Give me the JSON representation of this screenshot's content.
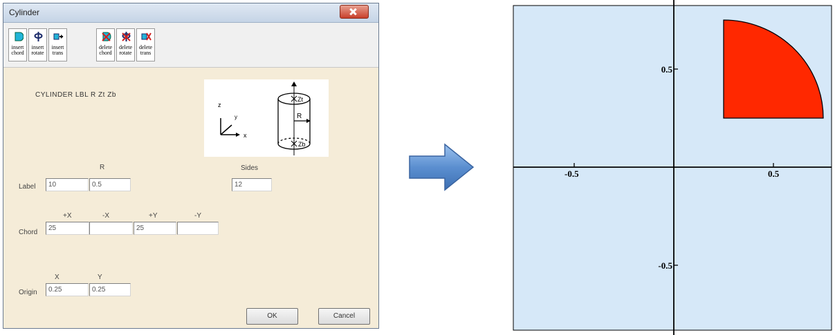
{
  "dialog": {
    "title": "Cylinder",
    "toolbar": [
      {
        "line1": "insert",
        "line2": "chord",
        "icon": "insert-chord-icon"
      },
      {
        "line1": "insert",
        "line2": "rotate",
        "icon": "insert-rotate-icon"
      },
      {
        "line1": "insert",
        "line2": "trans",
        "icon": "insert-trans-icon"
      },
      {
        "line1": "delete",
        "line2": "chord",
        "icon": "delete-chord-icon"
      },
      {
        "line1": "delete",
        "line2": "rotate",
        "icon": "delete-rotate-icon"
      },
      {
        "line1": "delete",
        "line2": "trans",
        "icon": "delete-trans-icon"
      }
    ],
    "header": "CYLINDER  LBL  R  Zt  Zb",
    "diagram": {
      "z": "z",
      "y": "y",
      "x": "x",
      "zt": "Zt",
      "r": "R",
      "zb": "Zb"
    },
    "label_row": {
      "row_label": "Label",
      "r_header": "R",
      "sides_header": "Sides",
      "label_value": "10",
      "r_value": "0.5",
      "sides_value": "12"
    },
    "chord_row": {
      "row_label": "Chord",
      "headers": [
        "+X",
        "-X",
        "+Y",
        "-Y"
      ],
      "values": [
        "25",
        "",
        "25",
        ""
      ]
    },
    "origin_row": {
      "row_label": "Origin",
      "headers": [
        "X",
        "Y"
      ],
      "values": [
        "0.25",
        "0.25"
      ]
    },
    "ok_label": "OK",
    "cancel_label": "Cancel"
  },
  "colors": {
    "dialog_bg": "#f5ecd8",
    "plot_bg": "#d6e8f8",
    "shape_fill": "#ff2800",
    "arrow": "#5b8fd0"
  },
  "plot": {
    "x_ticks": [
      "-0.5",
      "0.5"
    ],
    "y_ticks": [
      "0.5",
      "-0.5"
    ],
    "shape": {
      "type": "quarter-disc",
      "origin_x": 0.25,
      "origin_y": 0.25,
      "radius": 0.5
    }
  }
}
